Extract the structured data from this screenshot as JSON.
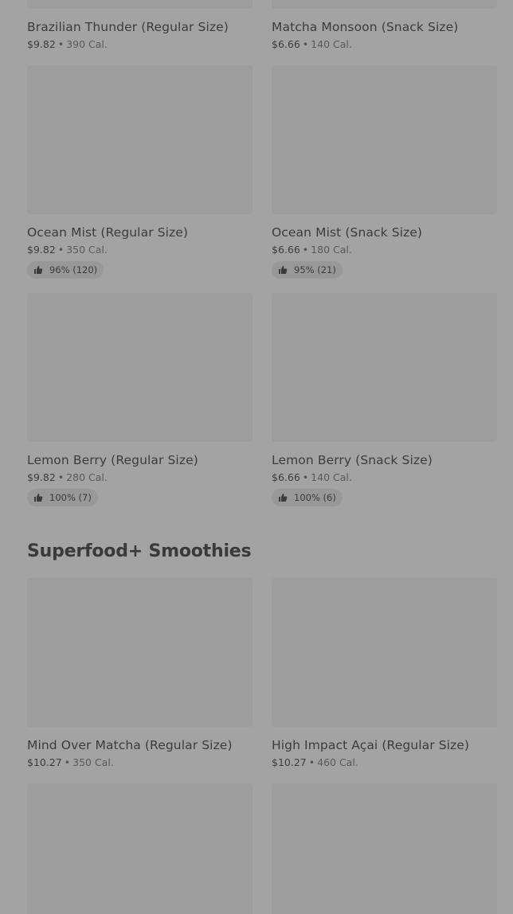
{
  "rows": [
    [
      {
        "name": "Brazilian Thunder (Regular Size)",
        "price": "$9.82",
        "cal": "390 Cal.",
        "rating": null
      },
      {
        "name": "Matcha Monsoon (Snack Size)",
        "price": "$6.66",
        "cal": "140 Cal.",
        "rating": null
      }
    ],
    [
      {
        "name": "Ocean Mist (Regular Size)",
        "price": "$9.82",
        "cal": "350 Cal.",
        "rating": "96% (120)"
      },
      {
        "name": "Ocean Mist (Snack Size)",
        "price": "$6.66",
        "cal": "180 Cal.",
        "rating": "95% (21)"
      }
    ],
    [
      {
        "name": "Lemon Berry (Regular Size)",
        "price": "$9.82",
        "cal": "280 Cal.",
        "rating": "100% (7)"
      },
      {
        "name": "Lemon Berry (Snack Size)",
        "price": "$6.66",
        "cal": "140 Cal.",
        "rating": "100% (6)"
      }
    ],
    [
      {
        "name": "Mind Over Matcha (Regular Size)",
        "price": "$10.27",
        "cal": "350 Cal.",
        "rating": null
      },
      {
        "name": "High Impact Açai (Regular Size)",
        "price": "$10.27",
        "cal": "460 Cal.",
        "rating": null
      }
    ],
    [
      {
        "name": "",
        "price": "",
        "cal": "",
        "rating": null
      },
      {
        "name": "",
        "price": "",
        "cal": "",
        "rating": null
      }
    ]
  ],
  "section": {
    "title": "Superfood+ Smoothies"
  },
  "separator": "•",
  "icons": {
    "rating": "thumbs-up-icon"
  }
}
